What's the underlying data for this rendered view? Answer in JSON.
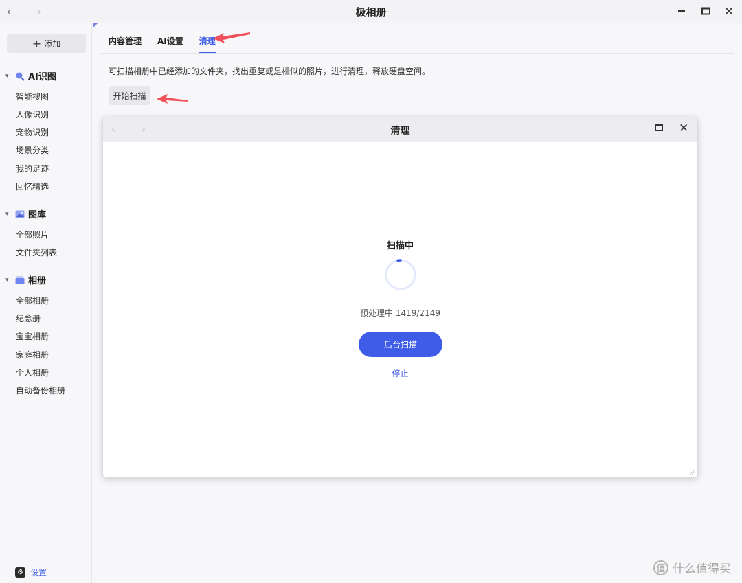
{
  "titlebar": {
    "title": "极相册",
    "back_icon": "chevron-left-icon",
    "forward_icon": "chevron-right-icon"
  },
  "sidebar": {
    "add_label": "添加",
    "groups": [
      {
        "label": "AI识图",
        "icon": "magnifier-icon",
        "items": [
          "智能搜图",
          "人像识别",
          "宠物识别",
          "场景分类",
          "我的足迹",
          "回忆精选"
        ]
      },
      {
        "label": "图库",
        "icon": "image-gallery-icon",
        "items": [
          "全部照片",
          "文件夹列表"
        ]
      },
      {
        "label": "相册",
        "icon": "album-icon",
        "items": [
          "全部相册",
          "纪念册",
          "宝宝相册",
          "家庭相册",
          "个人相册",
          "自动备份相册"
        ]
      }
    ],
    "settings_label": "设置"
  },
  "main": {
    "tabs": [
      {
        "label": "内容管理",
        "active": false
      },
      {
        "label": "AI设置",
        "active": false
      },
      {
        "label": "清理",
        "active": true
      }
    ],
    "description": "可扫描相册中已经添加的文件夹，找出重复或是相似的照片，进行清理，释放硬盘空间。",
    "scan_button": "开始扫描"
  },
  "dialog": {
    "title": "清理",
    "status": "扫描中",
    "progress_text": "预处理中 1419/2149",
    "progress": {
      "done": 1419,
      "total": 2149
    },
    "background_button": "后台扫描",
    "stop_link": "停止"
  },
  "watermark": {
    "text": "什么值得买"
  },
  "colors": {
    "accent": "#3f5ce8",
    "annotation_arrow": "#f0505a"
  }
}
